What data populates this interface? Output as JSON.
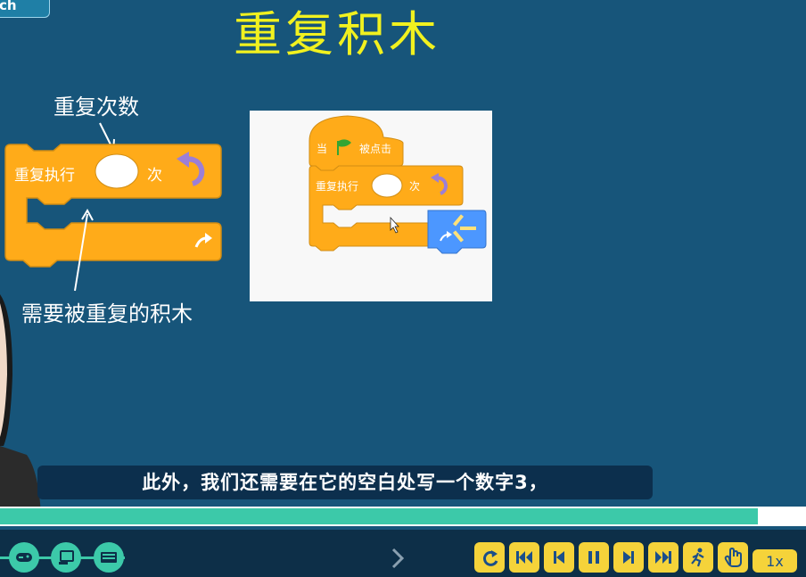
{
  "tag_label": "ch",
  "title": "重复积木",
  "annotations": {
    "repeat_count": "重复次数",
    "blocks_to_repeat": "需要被重复的积木"
  },
  "big_block": {
    "repeat_label": "重复执行",
    "times_label": "次"
  },
  "panel": {
    "hat_left": "当",
    "hat_right": "被点击",
    "repeat_label": "重复执行",
    "times_label": "次"
  },
  "subtitle": "此外，我们还需要在它的空白处写一个数字3，",
  "progress": {
    "value": 0.94
  },
  "controls": {
    "left_buttons": [
      "gamepad-icon",
      "monitor-pointer-icon",
      "keyboard-icon"
    ],
    "right_buttons": [
      "replay-icon",
      "skip-start-icon",
      "prev-icon",
      "pause-icon",
      "next-icon",
      "skip-end-icon",
      "run-icon",
      "hand-icon"
    ],
    "speed": "1x"
  },
  "colors": {
    "background": "#17557a",
    "title": "#f1f11f",
    "block_orange": "#ffab19",
    "block_blue": "#4c97ff",
    "progress": "#3cc9a9",
    "control_yellow": "#f5d33a"
  }
}
